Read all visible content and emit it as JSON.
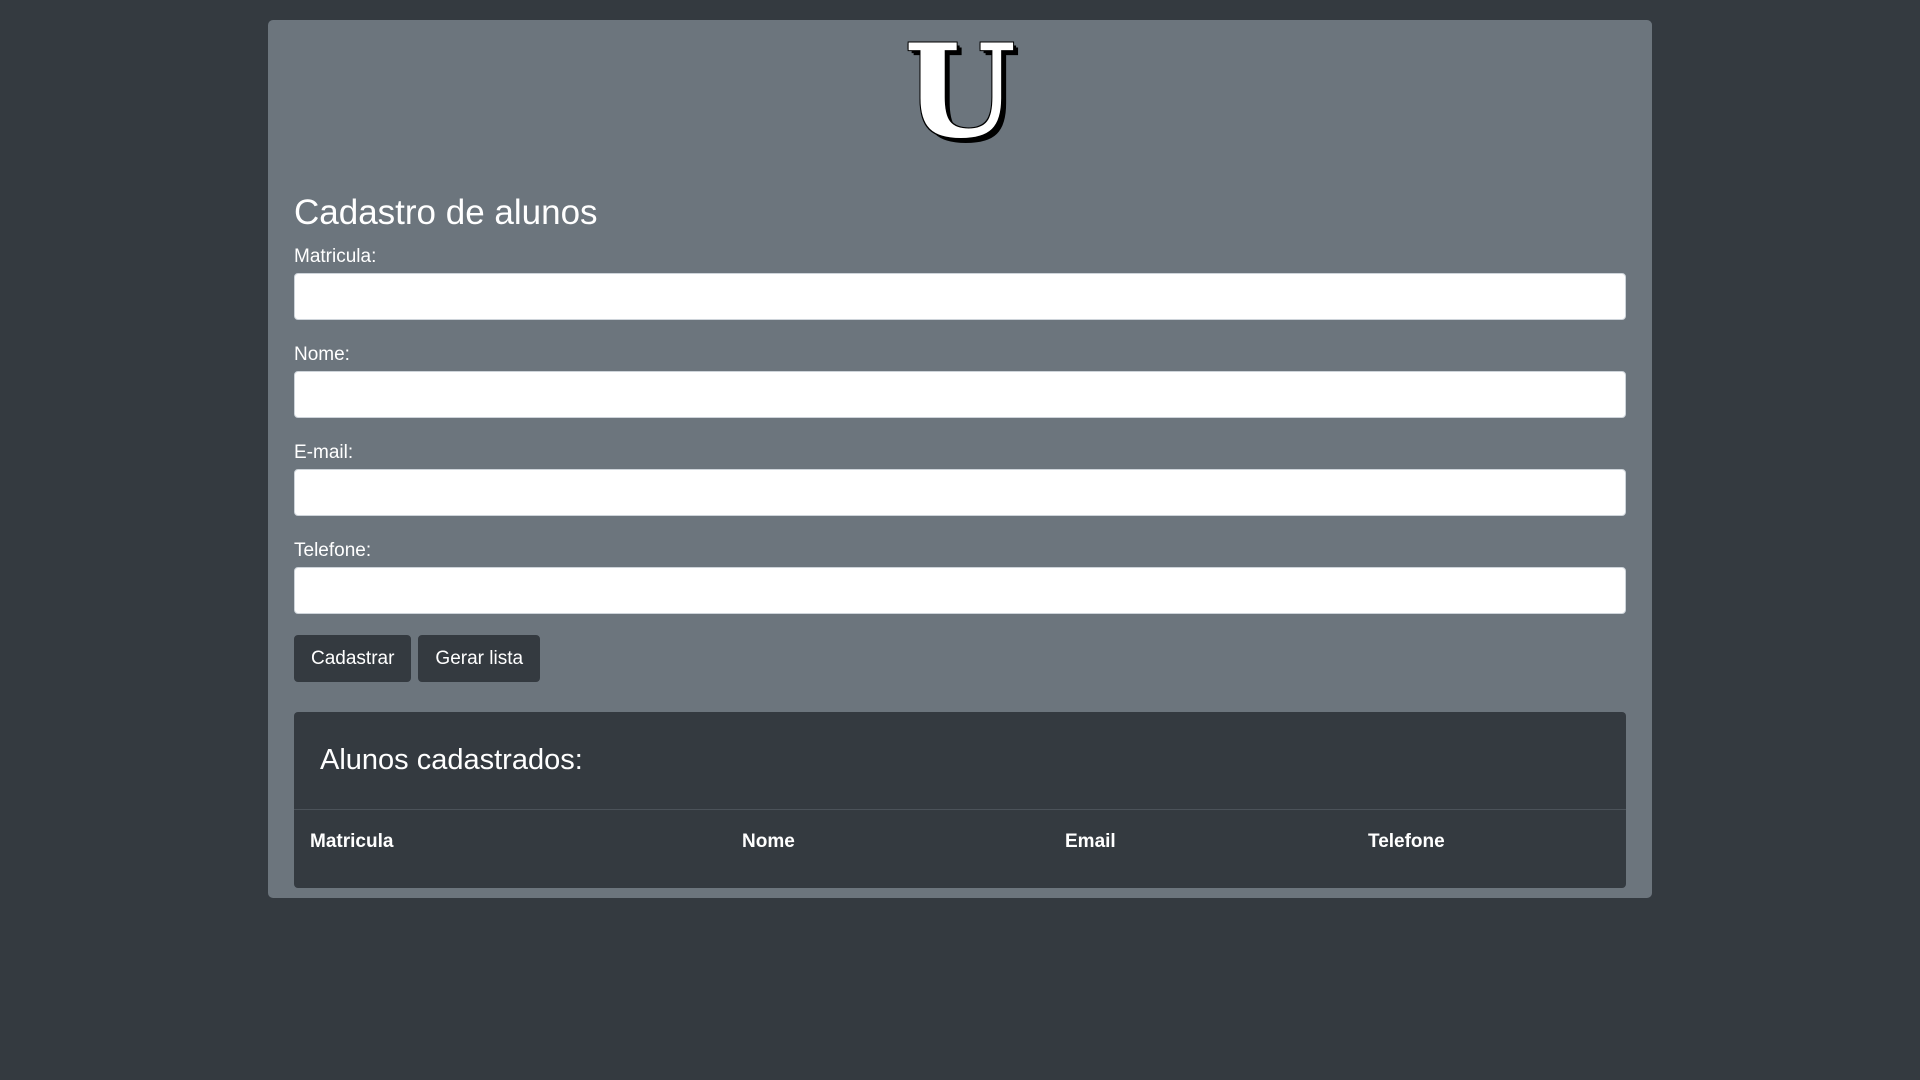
{
  "logo": {
    "letter": "U"
  },
  "form": {
    "title": "Cadastro de alunos",
    "fields": [
      {
        "label": "Matricula:",
        "value": "",
        "placeholder": ""
      },
      {
        "label": "Nome:",
        "value": "",
        "placeholder": ""
      },
      {
        "label": "E-mail:",
        "value": "",
        "placeholder": ""
      },
      {
        "label": "Telefone:",
        "value": "",
        "placeholder": ""
      }
    ],
    "buttons": {
      "register": "Cadastrar",
      "generate_list": "Gerar lista"
    }
  },
  "list": {
    "title": "Alunos cadastrados:",
    "columns": [
      "Matricula",
      "Nome",
      "Email",
      "Telefone"
    ],
    "rows": []
  },
  "colors": {
    "background": "#343a40",
    "panel": "#6c757d",
    "button": "#343a40",
    "text": "#ffffff"
  }
}
